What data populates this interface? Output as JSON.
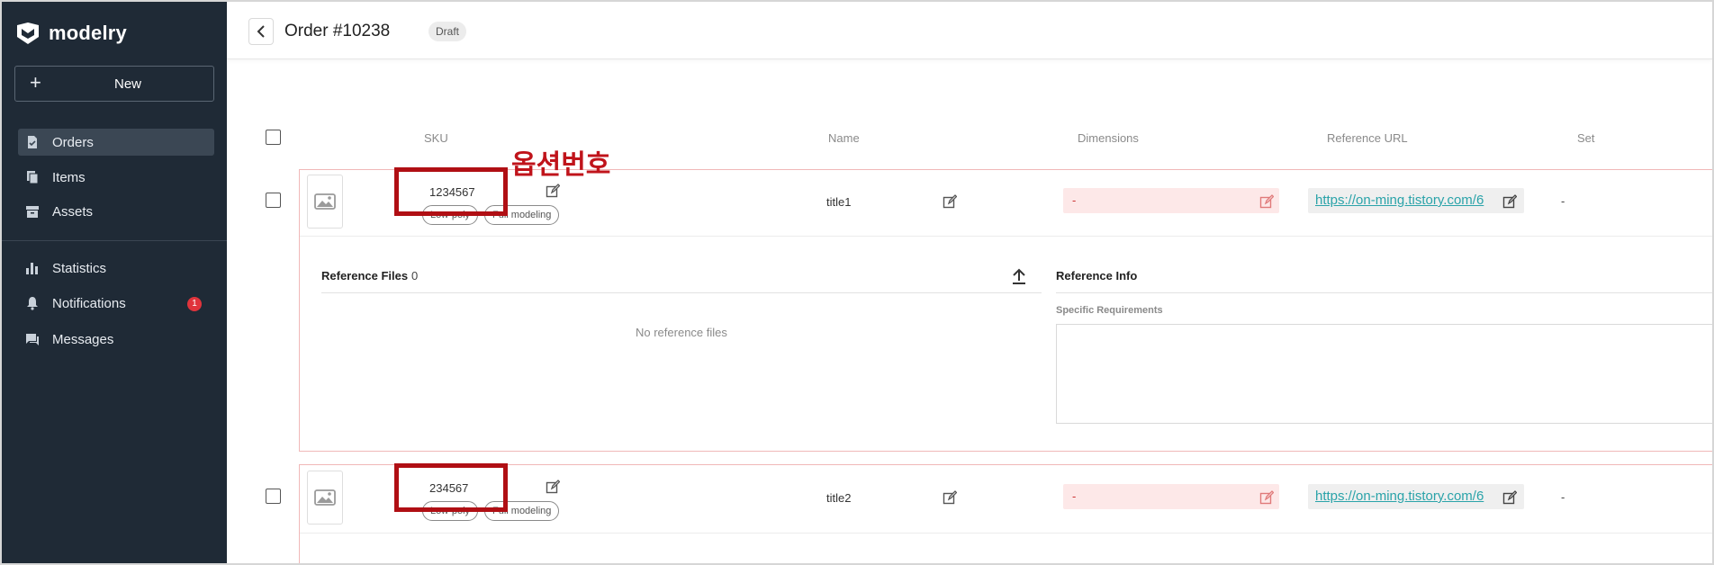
{
  "app": {
    "brand": "modelry"
  },
  "sidebar": {
    "new_label": "New",
    "items": [
      {
        "label": "Orders",
        "icon": "orders-icon",
        "active": true
      },
      {
        "label": "Items",
        "icon": "items-icon"
      },
      {
        "label": "Assets",
        "icon": "assets-icon"
      },
      {
        "label": "Statistics",
        "icon": "statistics-icon"
      },
      {
        "label": "Notifications",
        "icon": "bell-icon",
        "badge": "1"
      },
      {
        "label": "Messages",
        "icon": "messages-icon"
      }
    ]
  },
  "header": {
    "title": "Order #10238",
    "status": "Draft"
  },
  "table": {
    "columns": [
      "SKU",
      "Name",
      "Dimensions",
      "Reference URL",
      "Set"
    ],
    "rows": [
      {
        "sku": "1234567",
        "tags": [
          "Low-poly",
          "Full modeling"
        ],
        "name": "title1",
        "dimensions": "-",
        "url": "https://on-ming.tistory.com/6",
        "set": "-"
      },
      {
        "sku": "234567",
        "tags": [
          "Low-poly",
          "Full modeling"
        ],
        "name": "title2",
        "dimensions": "-",
        "url": "https://on-ming.tistory.com/6",
        "set": "-"
      }
    ]
  },
  "expanded": {
    "ref_files_title": "Reference Files",
    "ref_files_count": "0",
    "empty_message": "No reference files",
    "ref_info_title": "Reference Info",
    "specific_label": "Specific Requirements"
  },
  "annotation": {
    "label": "옵션번호",
    "color": "#c0141b"
  },
  "colors": {
    "sidebar_bg": "#1f2a36",
    "accent_link": "#2aa3a9",
    "error_bg": "#fde8e8",
    "badge": "#e0343c"
  }
}
